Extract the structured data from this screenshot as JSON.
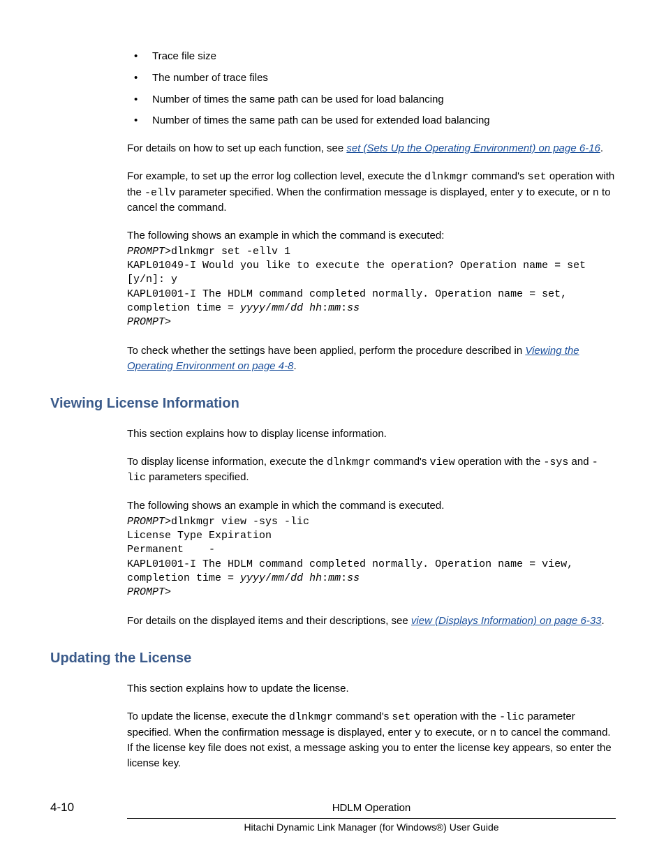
{
  "bullets": [
    "Trace file size",
    "The number of trace files",
    "Number of times the same path can be used for load balancing",
    "Number of times the same path can be used for extended load balancing"
  ],
  "para1a": "For details on how to set up each function, see ",
  "link1": "set (Sets Up the Operating Environment) on page 6-16",
  "para1b": ".",
  "para2_parts": {
    "a": "For example, to set up the error log collection level, execute the ",
    "b": "dlnkmgr",
    "c": " command's ",
    "d": "set",
    "e": " operation with the ",
    "f": "-ellv",
    "g": " parameter specified. When the confirmation message is displayed, enter ",
    "h": "y",
    "i": " to execute, or ",
    "j": "n",
    "k": " to cancel the command."
  },
  "para3": "The following shows an example in which the command is executed:",
  "code1": {
    "l1a": "PROMPT",
    "l1b": ">dlnkmgr set -ellv 1",
    "l2": "KAPL01049-I Would you like to execute the operation? Operation name = set [y/n]: y",
    "l3a": "KAPL01001-I The HDLM command completed normally. Operation name = set, completion time = ",
    "l3b": "yyyy",
    "l3c": "/",
    "l3d": "mm",
    "l3e": "/",
    "l3f": "dd hh",
    "l3g": ":",
    "l3h": "mm",
    "l3i": ":",
    "l3j": "ss",
    "l4": "PROMPT",
    "l4b": ">"
  },
  "para4a": "To check whether the settings have been applied, perform the procedure described in ",
  "link2": "Viewing the Operating Environment on page 4-8",
  "para4b": ".",
  "h_license": "Viewing License Information",
  "lic_p1": "This section explains how to display license information.",
  "lic_p2": {
    "a": "To display license information, execute the ",
    "b": "dlnkmgr",
    "c": " command's ",
    "d": "view",
    "e": " operation with the ",
    "f": "-sys",
    "g": " and ",
    "h": "-lic",
    "i": " parameters specified."
  },
  "lic_p3": "The following shows an example in which the command is executed.",
  "code2": {
    "l1a": "PROMPT",
    "l1b": ">dlnkmgr view -sys -lic",
    "l2": "License Type Expiration",
    "l3": "Permanent    -",
    "l4a": "KAPL01001-I The HDLM command completed normally. Operation name = view, completion time = ",
    "l4b": "yyyy",
    "l4c": "/",
    "l4d": "mm",
    "l4e": "/",
    "l4f": "dd hh",
    "l4g": ":",
    "l4h": "mm",
    "l4i": ":",
    "l4j": "ss",
    "l5": "PROMPT",
    "l5b": ">"
  },
  "lic_p4a": "For details on the displayed items and their descriptions, see ",
  "link3": "view (Displays Information) on page 6-33",
  "lic_p4b": ".",
  "h_update": "Updating the License",
  "upd_p1": "This section explains how to update the license.",
  "upd_p2": {
    "a": "To update the license, execute the ",
    "b": "dlnkmgr",
    "c": " command's ",
    "d": "set",
    "e": " operation with the ",
    "f": "-lic",
    "g": " parameter specified. When the confirmation message is displayed, enter ",
    "h": "y",
    "i": " to execute, or ",
    "j": "n",
    "k": " to cancel the command. If the license key file does not exist, a message asking you to enter the license key appears, so enter the license key."
  },
  "footer": {
    "page": "4-10",
    "center": "HDLM Operation",
    "bottom": "Hitachi Dynamic Link Manager (for Windows®) User Guide"
  }
}
